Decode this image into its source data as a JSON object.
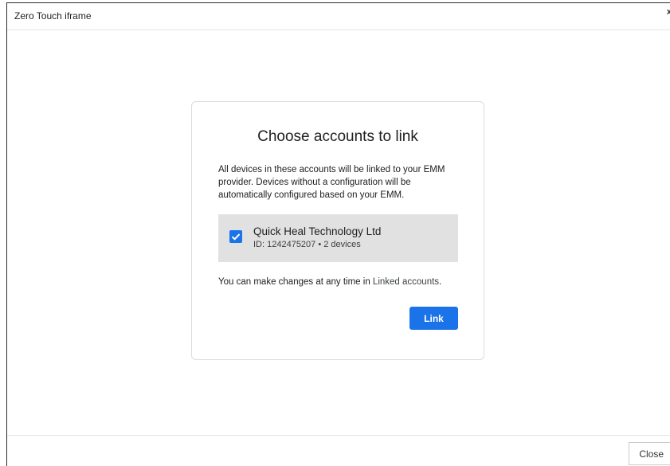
{
  "modal": {
    "title": "Zero Touch iframe",
    "close_x": "x",
    "close_button_label": "Close"
  },
  "card": {
    "title": "Choose accounts to link",
    "description": "All devices in these accounts will be linked to your EMM provider. Devices without a configuration will be automatically configured based on your EMM.",
    "account": {
      "name": "Quick Heal Technology Ltd",
      "meta": "ID: 1242475207 • 2 devices",
      "checked": true
    },
    "note_prefix": "You can make changes at any time in ",
    "note_link": "Linked accounts",
    "note_suffix": ".",
    "link_button_label": "Link"
  },
  "colors": {
    "accent": "#1a73e8",
    "row_background": "#e1e1e1"
  }
}
